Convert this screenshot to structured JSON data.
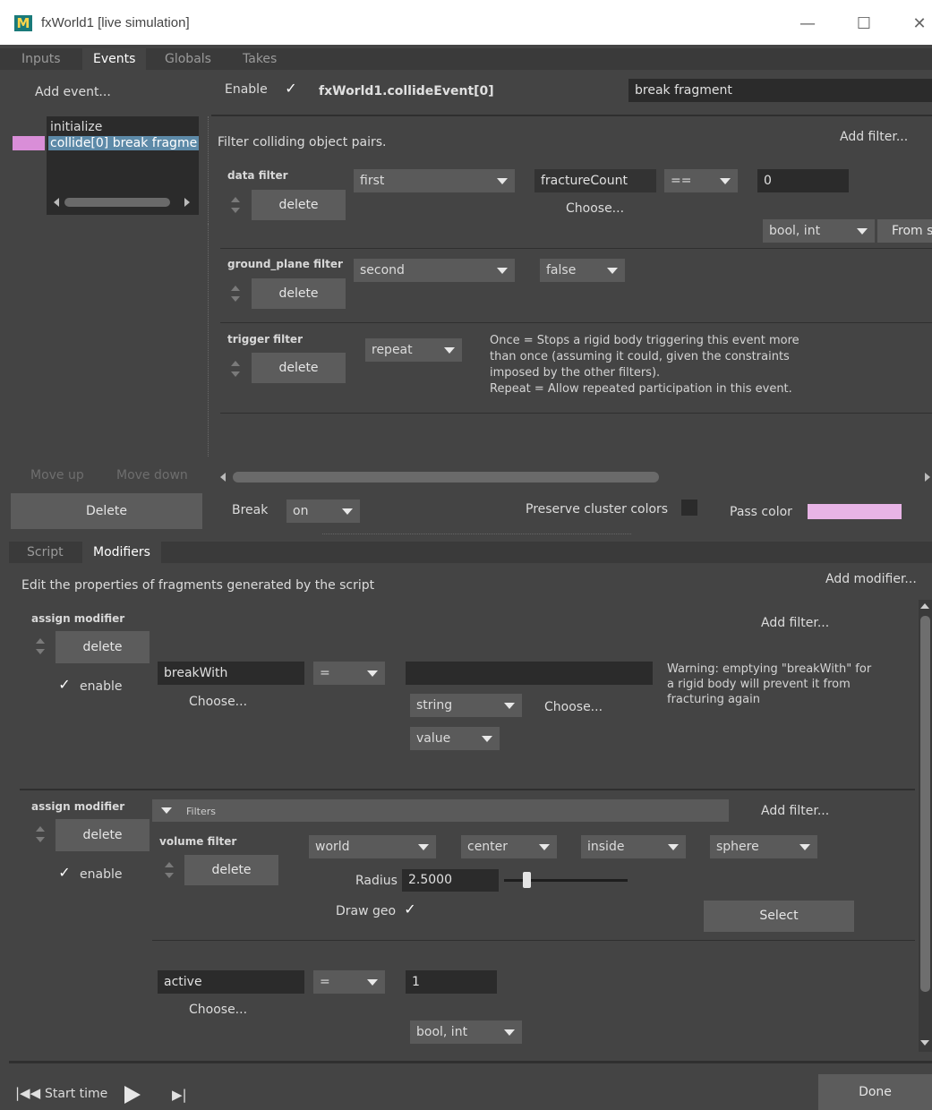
{
  "window": {
    "logo": "M",
    "title": "fxWorld1  [live simulation]",
    "minimize_icon": "—",
    "maximize_icon": "☐",
    "close_icon": "✕"
  },
  "top_tabs": [
    "Inputs",
    "Events",
    "Globals",
    "Takes"
  ],
  "events": {
    "add_event_label": "Add event...",
    "list": [
      "initialize",
      "collide[0] break fragme"
    ],
    "move_up": "Move up",
    "move_down": "Move down",
    "delete": "Delete",
    "enable_label": "Enable",
    "event_path": "fxWorld1.collideEvent[0]",
    "event_name": "break fragment",
    "filter_desc": "Filter colliding object pairs.",
    "add_filter": "Add filter...",
    "data_filter": {
      "label": "data filter",
      "delete": "delete",
      "which": "first",
      "attr": "fractureCount",
      "op": "==",
      "value": "0",
      "choose": "Choose...",
      "type": "bool, int",
      "from": "From s"
    },
    "ground_filter": {
      "label": "ground_plane filter",
      "delete": "delete",
      "which": "second",
      "value": "false"
    },
    "trigger_filter": {
      "label": "trigger filter",
      "delete": "delete",
      "mode": "repeat",
      "help": [
        "Once = Stops a rigid body triggering this event more",
        "than once (assuming it could, given the constraints",
        "imposed by the other filters).",
        "Repeat = Allow repeated participation in this event."
      ]
    },
    "break_label": "Break",
    "break_value": "on",
    "preserve_label": "Preserve cluster colors",
    "pass_color_label": "Pass color",
    "pass_color": "#e8b4e6",
    "list_color": "#d98ed8"
  },
  "bottom_tabs": [
    "Script",
    "Modifiers"
  ],
  "modifiers": {
    "desc": "Edit the properties of fragments generated by the script",
    "add_modifier": "Add modifier...",
    "m1": {
      "label": "assign modifier",
      "delete": "delete",
      "enable": "enable",
      "add_filter": "Add filter...",
      "attr": "breakWith",
      "op": "=",
      "value": "",
      "choose": "Choose...",
      "type": "string",
      "choose2": "Choose...",
      "mode": "value",
      "warning": [
        "Warning: emptying \"breakWith\" for",
        "a rigid body will prevent it from",
        "fracturing again"
      ]
    },
    "m2": {
      "label": "assign modifier",
      "delete": "delete",
      "enable": "enable",
      "filters_header": "Filters",
      "add_filter": "Add filter...",
      "volume_label": "volume filter",
      "volume_delete": "delete",
      "space": "world",
      "anchor": "center",
      "test": "inside",
      "shape": "sphere",
      "radius_label": "Radius",
      "radius": "2.5000",
      "radius_slider": 0.15,
      "draw_geo": "Draw geo",
      "select": "Select",
      "attr": "active",
      "op": "=",
      "value": "1",
      "choose": "Choose...",
      "type": "bool, int"
    }
  },
  "footer": {
    "start_time": "Start time",
    "done": "Done"
  }
}
